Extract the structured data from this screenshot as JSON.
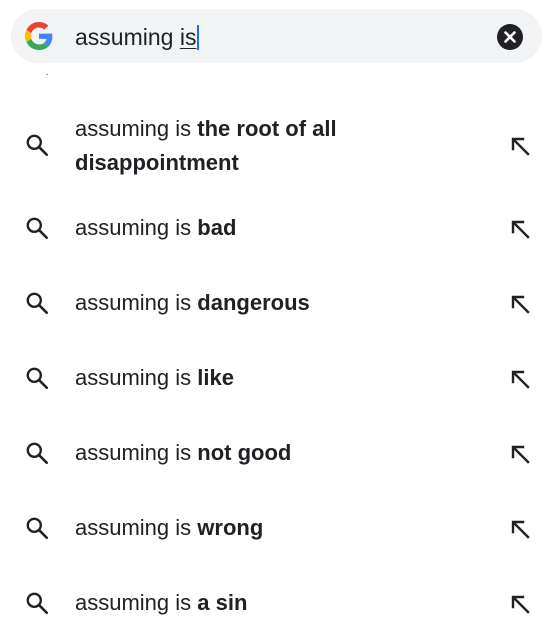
{
  "search": {
    "query_prefix": "assuming ",
    "query_selected": "is"
  },
  "suggestions": [
    {
      "prefix": "assuming is ",
      "bold": "the root of all disappointment"
    },
    {
      "prefix": "assuming is ",
      "bold": "bad"
    },
    {
      "prefix": "assuming is ",
      "bold": "dangerous"
    },
    {
      "prefix": "assuming is ",
      "bold": "like"
    },
    {
      "prefix": "assuming is ",
      "bold": "not good"
    },
    {
      "prefix": "assuming is ",
      "bold": "wrong"
    },
    {
      "prefix": "assuming is ",
      "bold": "a sin"
    }
  ],
  "icons": {
    "brand": "google-logo-icon",
    "clear": "clear-icon",
    "suggestion": "search-icon",
    "fill": "fill-query-arrow-icon"
  },
  "colors": {
    "bar_background": "#f1f3f4",
    "caret": "#1a73e8",
    "text": "#202124",
    "google_blue": "#4285F4",
    "google_red": "#EA4335",
    "google_yellow": "#FBBC05",
    "google_green": "#34A853"
  }
}
